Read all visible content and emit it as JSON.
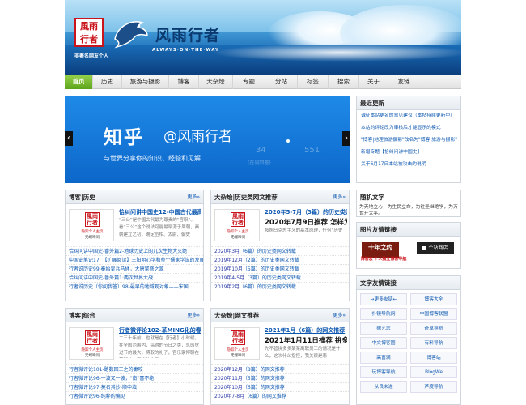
{
  "header": {
    "seal_text": "風雨行者",
    "title": "风雨行者",
    "subtitle": "ALWAYS·ON·THE·WAY",
    "motto": "非著名网友个人"
  },
  "nav": {
    "items": [
      "首页",
      "历史",
      "旅游与摄影",
      "博客",
      "大杂烩",
      "专题",
      "分站",
      "标签",
      "搜索",
      "关于",
      "友链"
    ],
    "active_index": 0
  },
  "slider": {
    "brand": "知乎",
    "handle": "@风雨行者",
    "tagline": "与世界分享你的知识、经验和见解",
    "ghost": [
      "34",
      "551",
      "(在问回答)"
    ]
  },
  "thumb": {
    "seal": "風雨行者",
    "caption1": "隐踪个人主页",
    "caption2": "无端啼问"
  },
  "boxes": {
    "history": {
      "title": "博客|历史",
      "more": "更多»",
      "feature_title": "恰纠问讲中国史12-中国古代最高",
      "feature_desc": "“三公”是中国古代最为尊贵的“官职”。看“三公”这个说法可能最早源于周朝，秦朝建立之初，确定丞相、太尉、御史",
      "items": [
        "恰纠问讲中国史-番外篇2-地球历史上的几次生物大灭绝",
        "中国史笔记17. 【扩展阅读】王阳明心学和整个儒家学说的发展",
        "行者说历史99.秦始皇兵马俑，大唐繁盛之源",
        "恰纠问讲中国史-番外篇1:两次世界大战",
        "行者说历史（你问我答）98-最早的地域观对象——宋国"
      ]
    },
    "misc_news": {
      "title": "大杂烩|历史类网文推荐",
      "more": "更多»",
      "feature_title": "2020年5-7月（3篇）的历史类网",
      "feature_title2": "2020年7月9日推荐 怎样为了",
      "feature_desc": "按照马克思主义的基本原理，任何“历史",
      "items": [
        {
          "date": "2020年3月",
          "text": "（6篇）的历史类网文转载"
        },
        {
          "date": "2019年12月",
          "text": "（2篇）的历史类网文转载"
        },
        {
          "date": "2019年10月",
          "text": "（5篇）的历史类网文转载"
        },
        {
          "date": "2019年4-5月",
          "text": "（3篇）的历史类网文转载"
        },
        {
          "date": "2019年2月",
          "text": "（6篇）的历史类网文转载"
        }
      ]
    },
    "blog": {
      "title": "博客|综合",
      "more": "更多»",
      "feature_title": "行者微评论102-革MING化的春节",
      "feature_desc": "二三十年前，也就是在【行者】小时候，在全国范围内，搞得的节日之类，总感觉过节的最大，博取的礼子，官乐家博聊在某部分，写出的礼子",
      "items": [
        "行者微评论101-路数回王之的癫咬",
        "行者微评论96-一波又一波，\"南\"喜不绝",
        "行者微评论97-莫名其妙-顺中填",
        "行者微评论96-纯粹的偏见"
      ]
    },
    "misc_web": {
      "title": "大杂烩|网文推荐",
      "more": "更多»",
      "feature_title": "2021年1月（6篇）的网文推荐",
      "feature_title2": "2021年1月11日推荐 拚多多",
      "feature_desc": "先不管拚多多某某离职员工的情况是什么，这次什么指控，我关很是悲",
      "items": [
        {
          "date": "2020年12月",
          "text": "（8篇）的网文推荐"
        },
        {
          "date": "2020年11月",
          "text": "（5篇）的网文推荐"
        },
        {
          "date": "2020年10月",
          "text": "（6篇）的网文推荐"
        },
        {
          "date": "2020年7-8月",
          "text": "（6篇）的网文推荐"
        }
      ]
    }
  },
  "sidebar": {
    "latest": {
      "title": "最近更新",
      "items": [
        "诚征本站更名的意见建议（本帖持续更新中）",
        "本站的评论改为审核后才能显示的模式",
        "\"博客|地理旅游摄影\"改名为\"博客|旅游与摄影\"",
        "新增专题【恰纠问讲中国史】",
        "关于6月17日本站被攻击的说明"
      ]
    },
    "random": {
      "title": "随机文字",
      "text": "为天地立心，为生民立命，为往圣继绝学，为万世开太平。"
    },
    "image_links": {
      "title": "图片友情链接",
      "items": [
        "十年之约",
        "个站商店"
      ],
      "sub": "博客志 个人独立博客导航"
    },
    "text_links": {
      "title": "文字友情链接",
      "items": [
        "→更多友链←",
        "博客大全",
        "扑镜导航网",
        "中国博客联盟",
        "德艺志",
        "奇草导航",
        "中文博客圈",
        "有料导航",
        "高富满",
        "博客站",
        "玩博客导航",
        "BlogWe",
        "从良未遂",
        "芦度导航"
      ]
    }
  }
}
